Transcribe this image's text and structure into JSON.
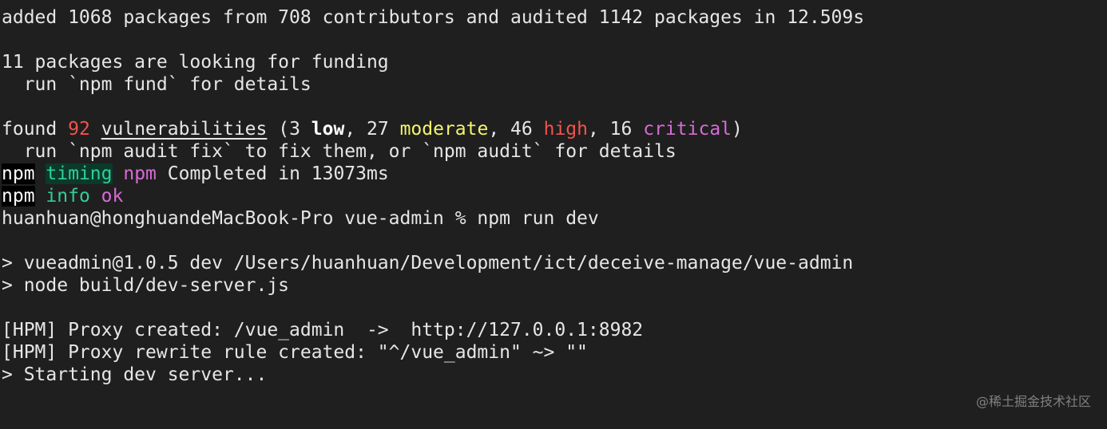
{
  "terminal": {
    "install": {
      "added_line": "added 1068 packages from 708 contributors and audited 1142 packages in 12.509s"
    },
    "funding": {
      "line1": "11 packages are looking for funding",
      "line2": "  run `npm fund` for details"
    },
    "vulnerabilities": {
      "found": "found ",
      "count": "92",
      "word": "vulnerabilities",
      "open": " (3 ",
      "low": "low",
      "sep1": ", 27 ",
      "moderate": "moderate",
      "sep2": ", 46 ",
      "high": "high",
      "sep3": ", 16 ",
      "critical": "critical",
      "close": ")",
      "advice": "  run `npm audit fix` to fix them, or `npm audit` for details"
    },
    "npm_timing": {
      "npm": "npm",
      "space": " ",
      "timing": "timing",
      "npm2": "npm",
      "msg": " Completed in 13073ms"
    },
    "npm_info": {
      "npm": "npm",
      "info": "info",
      "ok": "ok"
    },
    "prompt": {
      "text": "huanhuan@honghuandeMacBook-Pro vue-admin % npm run dev"
    },
    "run": {
      "line1": "> vueadmin@1.0.5 dev /Users/huanhuan/Development/ict/deceive-manage/vue-admin",
      "line2": "> node build/dev-server.js"
    },
    "hpm": {
      "line1": "[HPM] Proxy created: /vue_admin  ->  http://127.0.0.1:8982",
      "line2": "[HPM] Proxy rewrite rule created: \"^/vue_admin\" ~> \"\"",
      "line3": "> Starting dev server..."
    },
    "watermark": "@稀土掘金技术社区"
  },
  "colors": {
    "background": "#1f1f1f",
    "foreground": "#e6e6e6",
    "red": "#f1534d",
    "yellow": "#f4f36d",
    "magenta": "#d66bd6",
    "green": "#2fcf99"
  }
}
